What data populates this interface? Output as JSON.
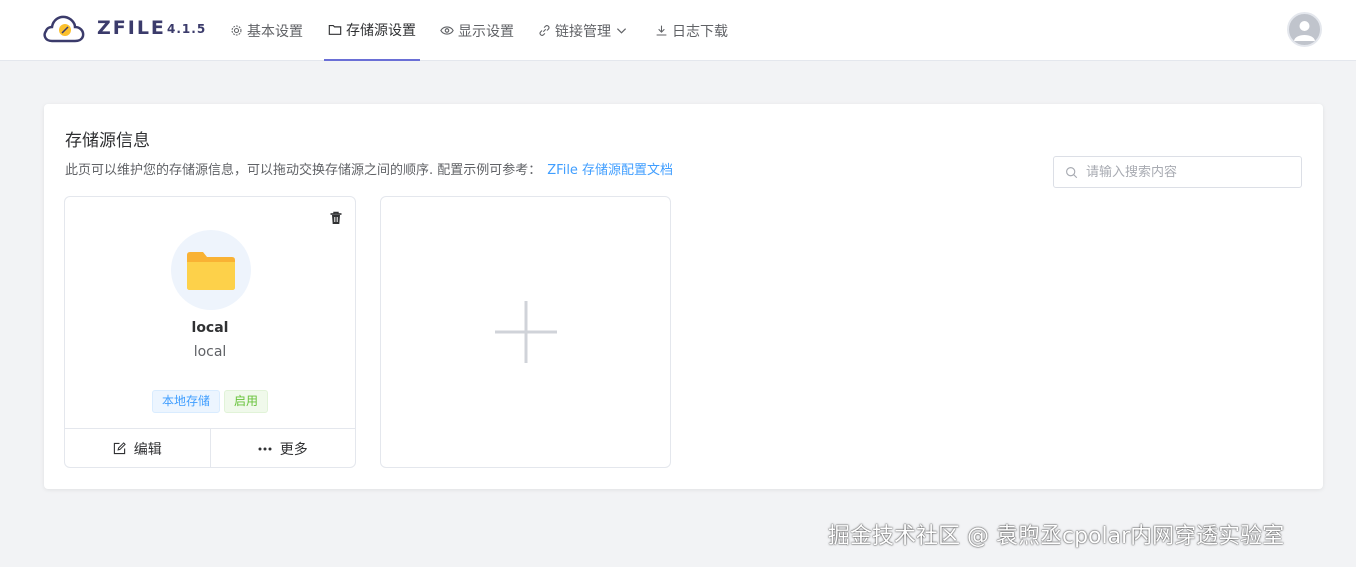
{
  "header": {
    "brand": "ZFILE",
    "version": "4.1.5",
    "nav": [
      {
        "label": "基本设置",
        "icon": "gear-icon"
      },
      {
        "label": "存储源设置",
        "icon": "folder-icon"
      },
      {
        "label": "显示设置",
        "icon": "eye-icon"
      },
      {
        "label": "链接管理",
        "icon": "link-icon"
      },
      {
        "label": "日志下载",
        "icon": "download-icon"
      }
    ],
    "active_nav": "存储源设置"
  },
  "panel": {
    "title": "存储源信息",
    "description": "此页可以维护您的存储源信息，可以拖动交换存储源之间的顺序. 配置示例可参考：",
    "doc_link": "ZFile 存储源配置文档",
    "search_placeholder": "请输入搜索内容"
  },
  "storages": [
    {
      "name": "local",
      "type": "local",
      "tags": [
        "本地存储",
        "启用"
      ],
      "actions": [
        "编辑",
        "更多"
      ]
    }
  ],
  "watermark": "掘金技术社区 @ 袁煦丞cpolar内网穿透实验室",
  "colors": {
    "accent": "#6a6fd6",
    "link": "#409eff",
    "tag_blue": "#409eff",
    "tag_green": "#67c23a",
    "folder": "#fbbf24"
  }
}
